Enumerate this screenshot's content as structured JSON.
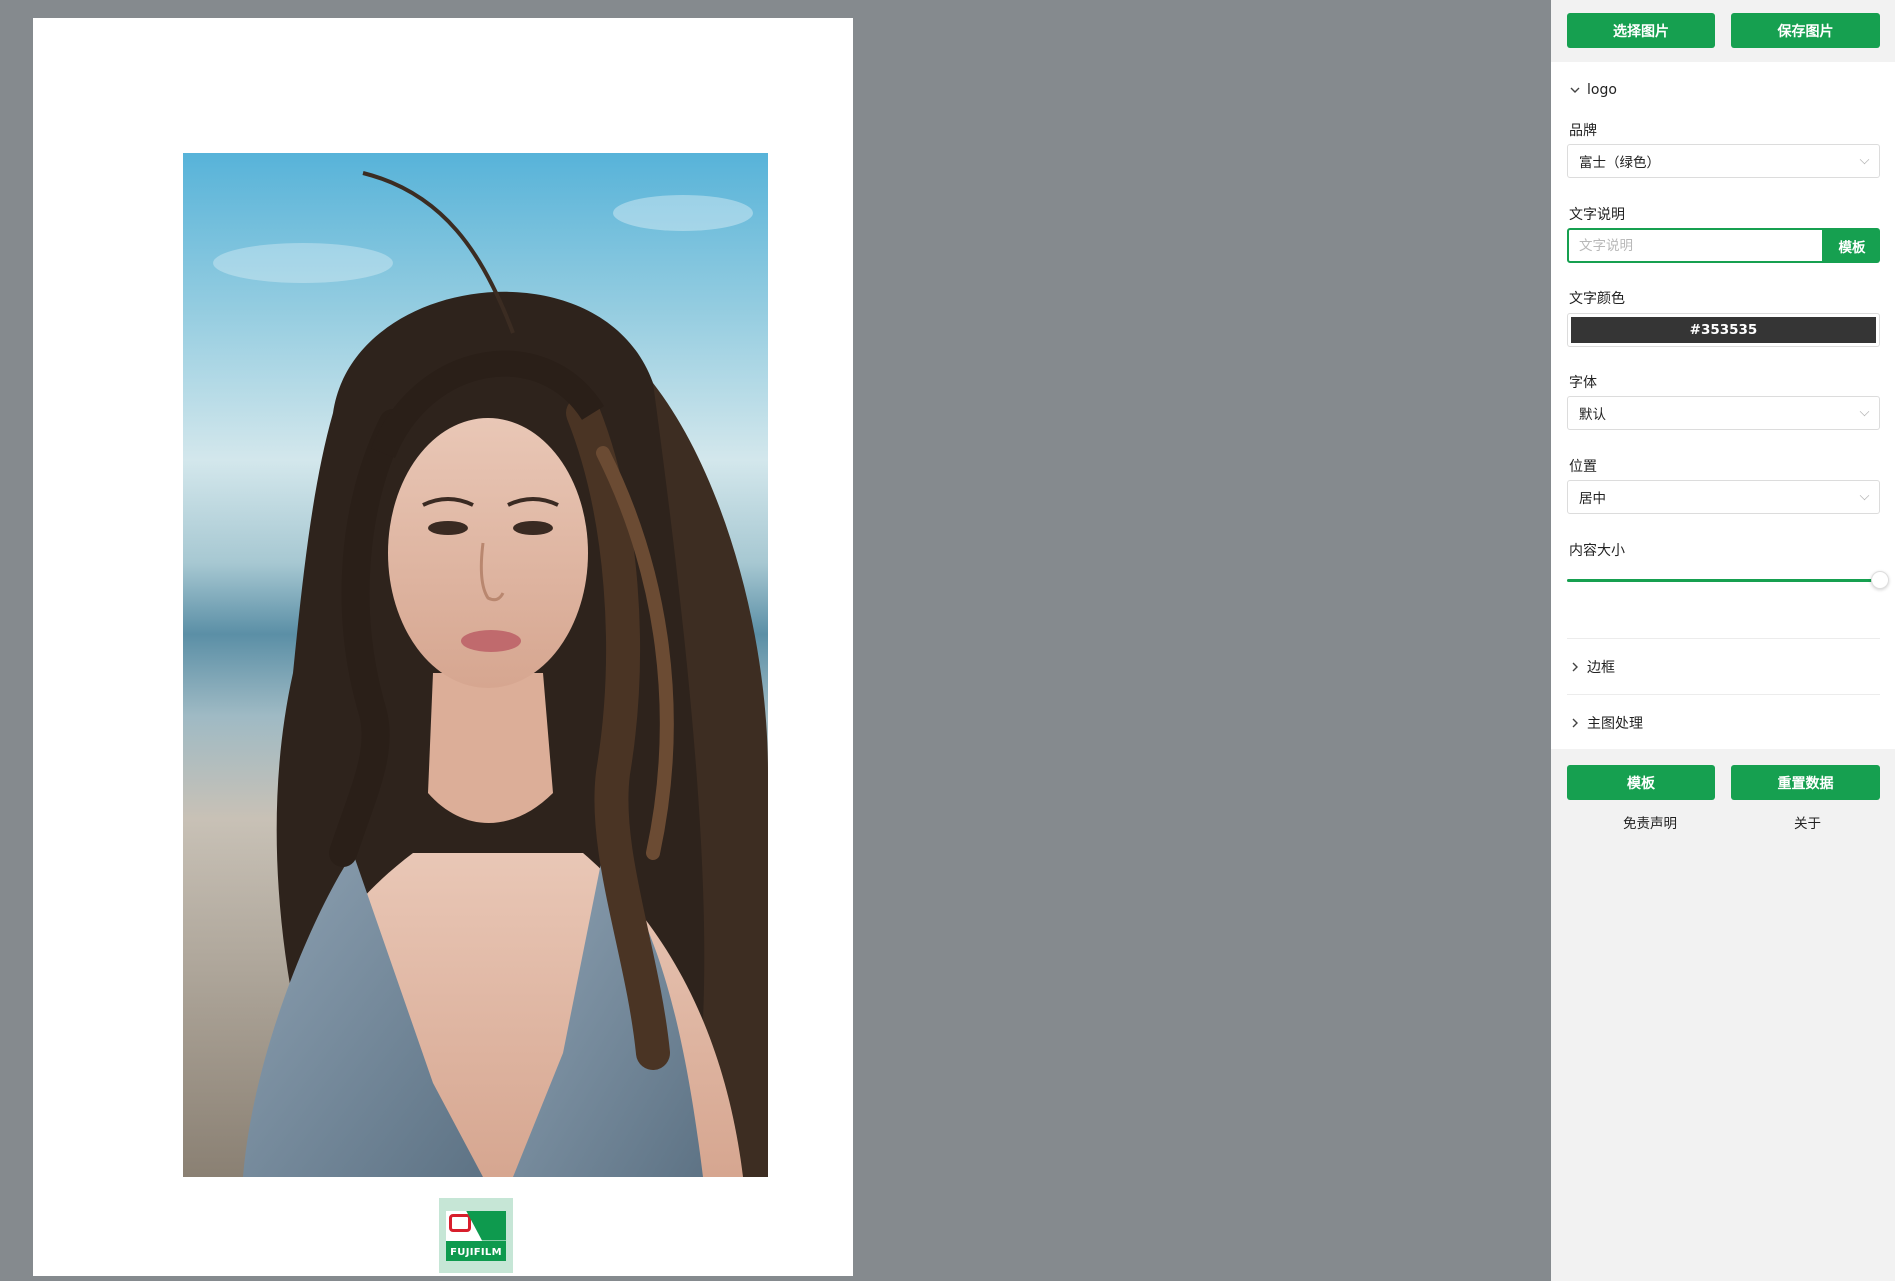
{
  "toolbar": {
    "select_image_label": "选择图片",
    "save_image_label": "保存图片"
  },
  "logo_section": {
    "title": "logo",
    "expanded": true,
    "brand": {
      "label": "品牌",
      "value": "富士（绿色）"
    },
    "caption": {
      "label": "文字说明",
      "value": "",
      "placeholder": "文字说明",
      "template_button": "模板"
    },
    "text_color": {
      "label": "文字颜色",
      "value": "#353535"
    },
    "font": {
      "label": "字体",
      "value": "默认"
    },
    "position": {
      "label": "位置",
      "value": "居中"
    },
    "content_size": {
      "label": "内容大小",
      "value_fraction": 1.0
    }
  },
  "border_section": {
    "title": "边框",
    "expanded": false
  },
  "main_image_section": {
    "title": "主图处理",
    "expanded": false
  },
  "footer": {
    "template_label": "模板",
    "reset_label": "重置数据",
    "disclaimer_label": "免责声明",
    "about_label": "关于"
  },
  "preview": {
    "brand_logo_text": "FUJIFILM"
  },
  "colors": {
    "accent": "#16a050",
    "canvas_background": "#858a8e",
    "sidebar_background": "#f2f2f2"
  },
  "icons": {
    "expanded": "chevron-down-icon",
    "collapsed": "chevron-right-icon",
    "dropdown": "caret-down-icon"
  }
}
